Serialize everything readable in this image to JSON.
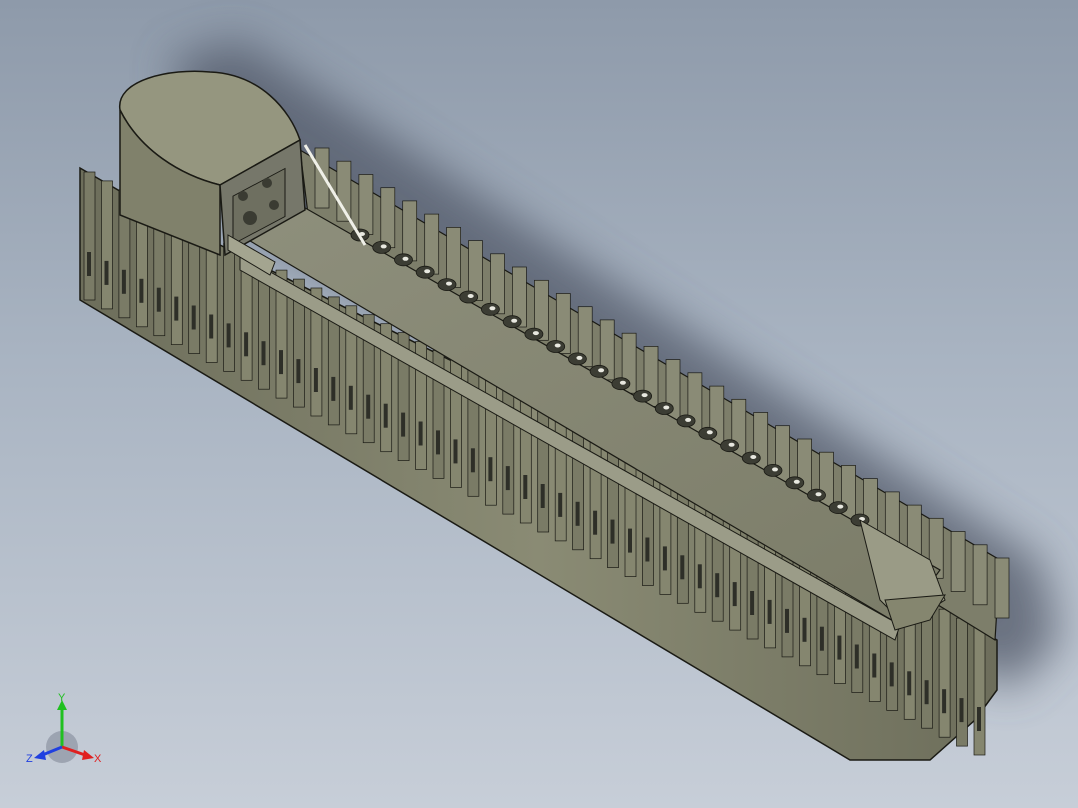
{
  "viewport": {
    "background_top": "#8e9aaa",
    "background_bottom": "#c7ced8"
  },
  "model": {
    "body_color": "#8f9078",
    "shadow_color": "#5a6170",
    "outline_color": "#1a1a14"
  },
  "triad": {
    "y_label": "Y",
    "x_label": "X",
    "z_label": "Z",
    "x_color": "#e02020",
    "y_color": "#20c020",
    "z_color": "#2040e0"
  }
}
